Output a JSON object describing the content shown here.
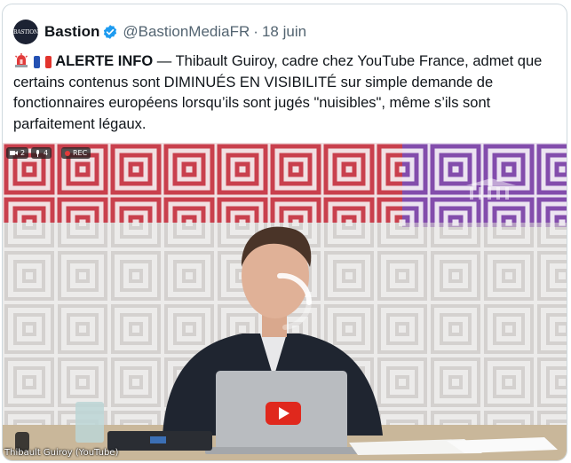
{
  "tweet": {
    "display_name": "Bastion",
    "handle": "@BastionMediaFR",
    "separator": "·",
    "date": "18 juin",
    "avatar_text": "BASTION",
    "alert_label": "ALERTE INFO",
    "body": "— Thibault Guiroy, cadre chez YouTube France, admet que certains contenus sont DIMINUÉS EN VISIBILITÉ sur simple demande de fonctionnaires européens lorsqu’ils sont jugés \"nuisibles\", même s’ils sont parfaitement légaux."
  },
  "media": {
    "overlay_cam_count": "2",
    "overlay_mic_count": "4",
    "overlay_rec_label": "REC",
    "caption": "Thibault Guiroy (YouTube)"
  },
  "colors": {
    "verified_blue": "#1d9bf0",
    "pattern_red": "#c8303f",
    "pattern_purple": "#7a3ea8",
    "youtube_red": "#e0281d"
  },
  "icons": [
    "verified-badge-icon",
    "siren-icon",
    "french-flag-icon",
    "camera-icon",
    "mic-icon",
    "rec-icon",
    "youtube-logo-icon",
    "loading-spinner-icon"
  ]
}
